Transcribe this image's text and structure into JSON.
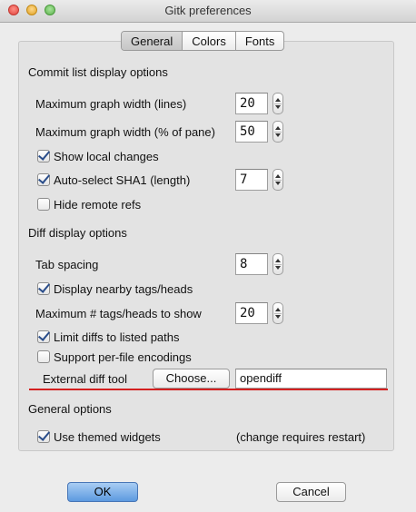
{
  "window": {
    "title": "Gitk preferences"
  },
  "tabs": [
    {
      "label": "General",
      "active": true
    },
    {
      "label": "Colors",
      "active": false
    },
    {
      "label": "Fonts",
      "active": false
    }
  ],
  "commit": {
    "heading": "Commit list display options",
    "max_graph_width_lines": {
      "label": "Maximum graph width (lines)",
      "value": "20"
    },
    "max_graph_width_pct": {
      "label": "Maximum graph width (% of pane)",
      "value": "50"
    },
    "show_local_changes": {
      "label": "Show local changes",
      "checked": true
    },
    "auto_select_sha1": {
      "label": "Auto-select SHA1 (length)",
      "checked": true,
      "value": "7"
    },
    "hide_remote_refs": {
      "label": "Hide remote refs",
      "checked": false
    }
  },
  "diff": {
    "heading": "Diff display options",
    "tab_spacing": {
      "label": "Tab spacing",
      "value": "8"
    },
    "nearby_tags": {
      "label": "Display nearby tags/heads",
      "checked": true
    },
    "max_tags": {
      "label": "Maximum # tags/heads to show",
      "value": "20"
    },
    "limit_diffs": {
      "label": "Limit diffs to listed paths",
      "checked": true
    },
    "per_file_encodings": {
      "label": "Support per-file encodings",
      "checked": false
    },
    "external_diff": {
      "label": "External diff tool",
      "button": "Choose...",
      "value": "opendiff"
    }
  },
  "general": {
    "heading": "General options",
    "themed_widgets": {
      "label": "Use themed widgets",
      "checked": true
    },
    "restart_note": "(change requires restart)"
  },
  "footer": {
    "ok_label": "OK",
    "cancel_label": "Cancel"
  },
  "colors": {
    "annotation_line": "#d42020",
    "ok_button": "#5d9ae0"
  }
}
